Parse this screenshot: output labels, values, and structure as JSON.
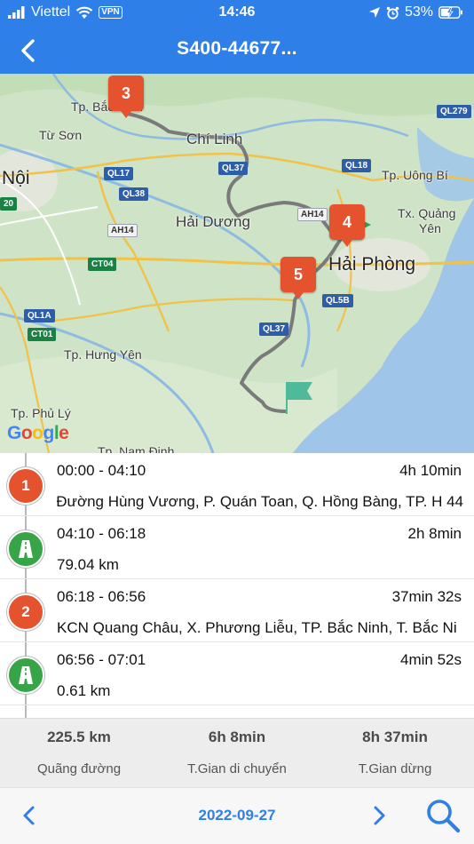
{
  "status_bar": {
    "carrier": "Viettel",
    "vpn": "VPN",
    "time": "14:46",
    "battery": "53%"
  },
  "header": {
    "title": "S400-44677..."
  },
  "map": {
    "places": {
      "bac_ninh": "Tp. Bắc Ninh",
      "tu_son": "Từ Sơn",
      "chi_linh": "Chí Linh",
      "ha_noi": "Nội",
      "hai_duong": "Hải Dương",
      "hai_phong": "Hải Phòng",
      "uong_bi": "Tp. Uông Bí",
      "quang_yen_1": "Tx. Quảng",
      "quang_yen_2": "Yên",
      "hung_yen": "Tp. Hưng Yên",
      "phu_ly": "Tp. Phủ Lý",
      "nam_dinh": "Tp. Nam Định"
    },
    "roads": {
      "ql279": "QL279",
      "ql17": "QL17",
      "ql38": "QL38",
      "ql37a": "QL37",
      "ql18": "QL18",
      "ah14a": "AH14",
      "ah14b": "AH14",
      "ct04": "CT04",
      "ql1a": "QL1A",
      "ct01": "CT01",
      "ql37b": "QL37",
      "ql5b": "QL5B",
      "num20": "20"
    },
    "markers": [
      "3",
      "4",
      "5"
    ],
    "google_logo": "Google",
    "colors": {
      "marker": "#e4532e",
      "route": "#7a7a7a",
      "start_flag": "#2fa14f",
      "end_flag": "#4fb99a"
    }
  },
  "timeline": [
    {
      "type": "stop",
      "icon_label": "1",
      "time": "00:00 - 04:10",
      "duration": "4h 10min",
      "detail": "44 Đường Hùng Vương, P. Quán Toan, Q. Hồng Bàng, TP. H"
    },
    {
      "type": "drive",
      "icon": "road-icon",
      "time": "04:10 - 06:18",
      "duration": "2h 8min",
      "detail": "79.04 km"
    },
    {
      "type": "stop",
      "icon_label": "2",
      "time": "06:18 - 06:56",
      "duration": "37min 32s",
      "detail": "KCN Quang Châu, X. Phương Liễu, TP. Bắc Ninh, T. Bắc Ni"
    },
    {
      "type": "drive",
      "icon": "road-icon",
      "time": "06:56 - 07:01",
      "duration": "4min 52s",
      "detail": "0.61 km"
    }
  ],
  "summary": {
    "distance_value": "225.5 km",
    "distance_label": "Quãng đường",
    "moving_value": "6h 8min",
    "moving_label": "T.Gian di chuyển",
    "stop_value": "8h 37min",
    "stop_label": "T.Gian dừng"
  },
  "bottom_bar": {
    "date": "2022-09-27"
  },
  "colors": {
    "header_bg": "#2f7fe9",
    "accent": "#2f7fe9",
    "stop_icon": "#e4532e",
    "drive_icon": "#37a447"
  }
}
